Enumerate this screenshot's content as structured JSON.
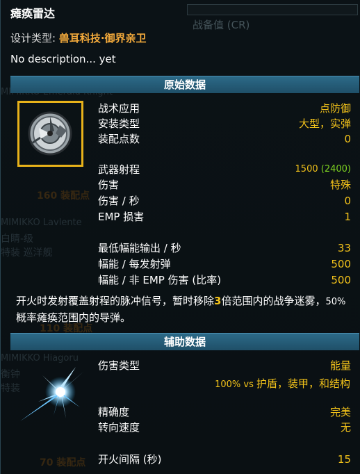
{
  "title": "瘫痪雷达",
  "cr_label": "战备值 (CR)",
  "design_type": {
    "label": "设计类型:",
    "value": "兽耳科技·御界亲卫"
  },
  "description": "No description... yet",
  "background_ghosts": [
    "MIMIKKO Emerald Knight",
    "160 装配点",
    "MIMIKKO Lavlente",
    "白睛-级",
    "特装 巡洋舰",
    "110 装配点",
    "MIMIKKO Hiagoru",
    "衡钟",
    "特装",
    "70 装配点"
  ],
  "sections": {
    "primary": "原始数据",
    "ancillary": "辅助数据"
  },
  "primary": {
    "role": {
      "label": "战术应用",
      "value": "点防御"
    },
    "mount": {
      "label": "安装类型",
      "value": "大型，实弹"
    },
    "op": {
      "label": "装配点数",
      "value": "0"
    },
    "range": {
      "label": "武器射程",
      "value": "1500",
      "value_extra": "(2400)"
    },
    "damage": {
      "label": "伤害",
      "value": "特殊"
    },
    "dps": {
      "label": "伤害 / 秒",
      "value": "0"
    },
    "emp": {
      "label": "EMP 损害",
      "value": "1"
    },
    "min_flux": {
      "label": "最低幅能输出 / 秒",
      "value": "33"
    },
    "flux_shot": {
      "label": "幅能 / 每发射弹",
      "value": "500"
    },
    "flux_emp": {
      "label": "幅能 / 非 EMP 伤害 (比率)",
      "value": "500"
    }
  },
  "info_text": {
    "part1": "开火时发射覆盖射程的脉冲信号，暂时移除",
    "highlight": "3",
    "part2": "倍范围内的战争迷雾，",
    "small": "50%",
    "part3": "概率瘫痪范围内的导弹。"
  },
  "ancillary": {
    "damage_type": {
      "label": "伤害类型",
      "value": "能量"
    },
    "damage_mult": {
      "small": "100% vs",
      "value": "护盾，装甲，和结构"
    },
    "accuracy": {
      "label": "精确度",
      "value": "完美"
    },
    "turn": {
      "label": "转向速度",
      "value": "无"
    },
    "refire": {
      "label": "开火间隔 (秒)",
      "value": "15"
    }
  },
  "colors": {
    "accent_yellow": "#f2c21a",
    "accent_orange": "#f2a93b",
    "section_blue": "#2c6a88",
    "range_green": "#7ed321"
  },
  "icons": {
    "weapon": "radar-dish-icon",
    "energy": "energy-burst-icon"
  }
}
